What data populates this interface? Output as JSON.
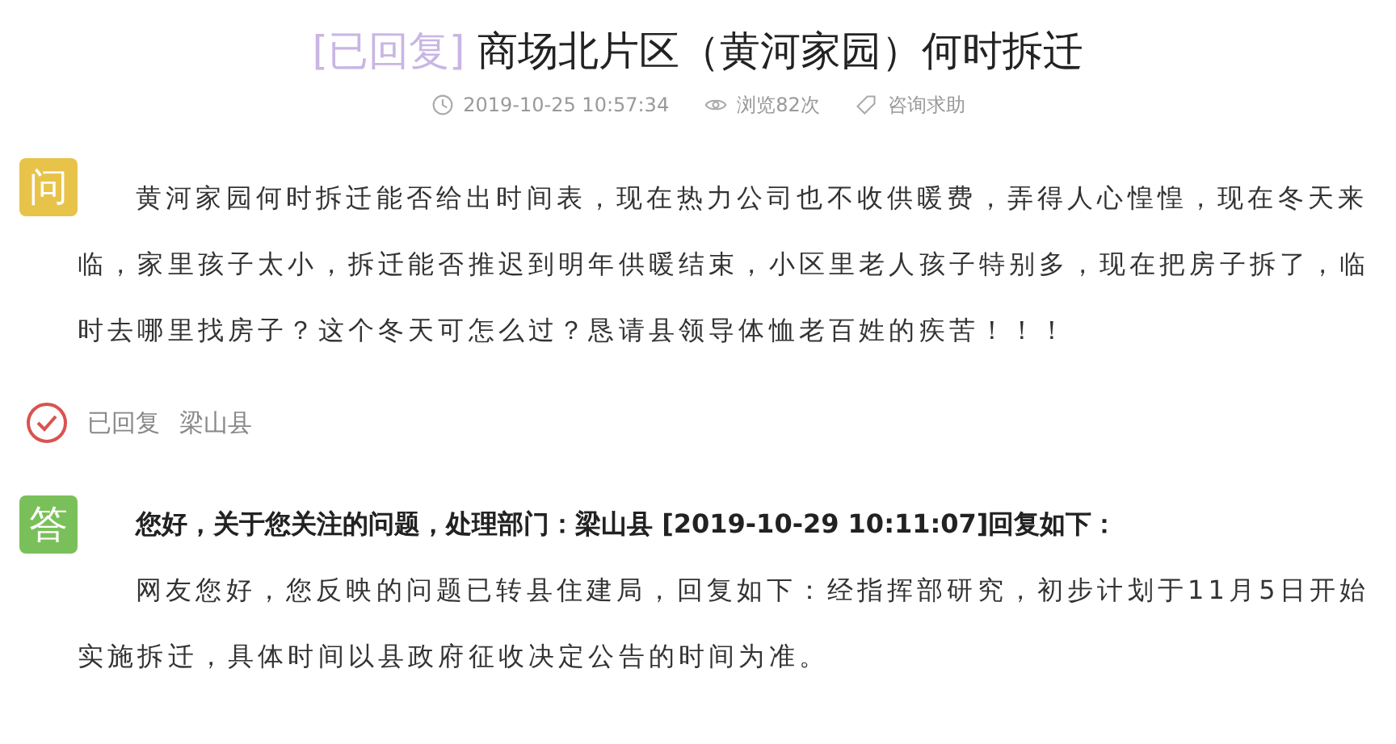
{
  "title": {
    "tag": "[已回复]",
    "text": "商场北片区（黄河家园）何时拆迁"
  },
  "meta": [
    {
      "kind": "clock",
      "text": "2019-10-25 10:57:34"
    },
    {
      "kind": "eye",
      "text": "浏览82次"
    },
    {
      "kind": "tag",
      "text": "咨询求助"
    }
  ],
  "question": {
    "badge": "问",
    "text": "黄河家园何时拆迁能否给出时间表，现在热力公司也不收供暖费，弄得人心惶惶，现在冬天来临，家里孩子太小，拆迁能否推迟到明年供暖结束，小区里老人孩子特别多，现在把房子拆了，临时去哪里找房子？这个冬天可怎么过？恳请县领导体恤老百姓的疾苦！！！"
  },
  "status": {
    "replied": true,
    "label": "已回复",
    "department": "梁山县"
  },
  "answer": {
    "badge": "答",
    "heading": "您好，关于您关注的问题，处理部门：梁山县 [2019-10-29 10:11:07]回复如下：",
    "text": "网友您好，您反映的问题已转县住建局，回复如下：经指挥部研究，初步计划于11月5日开始实施拆迁，具体时间以县政府征收决定公告的时间为准。"
  }
}
